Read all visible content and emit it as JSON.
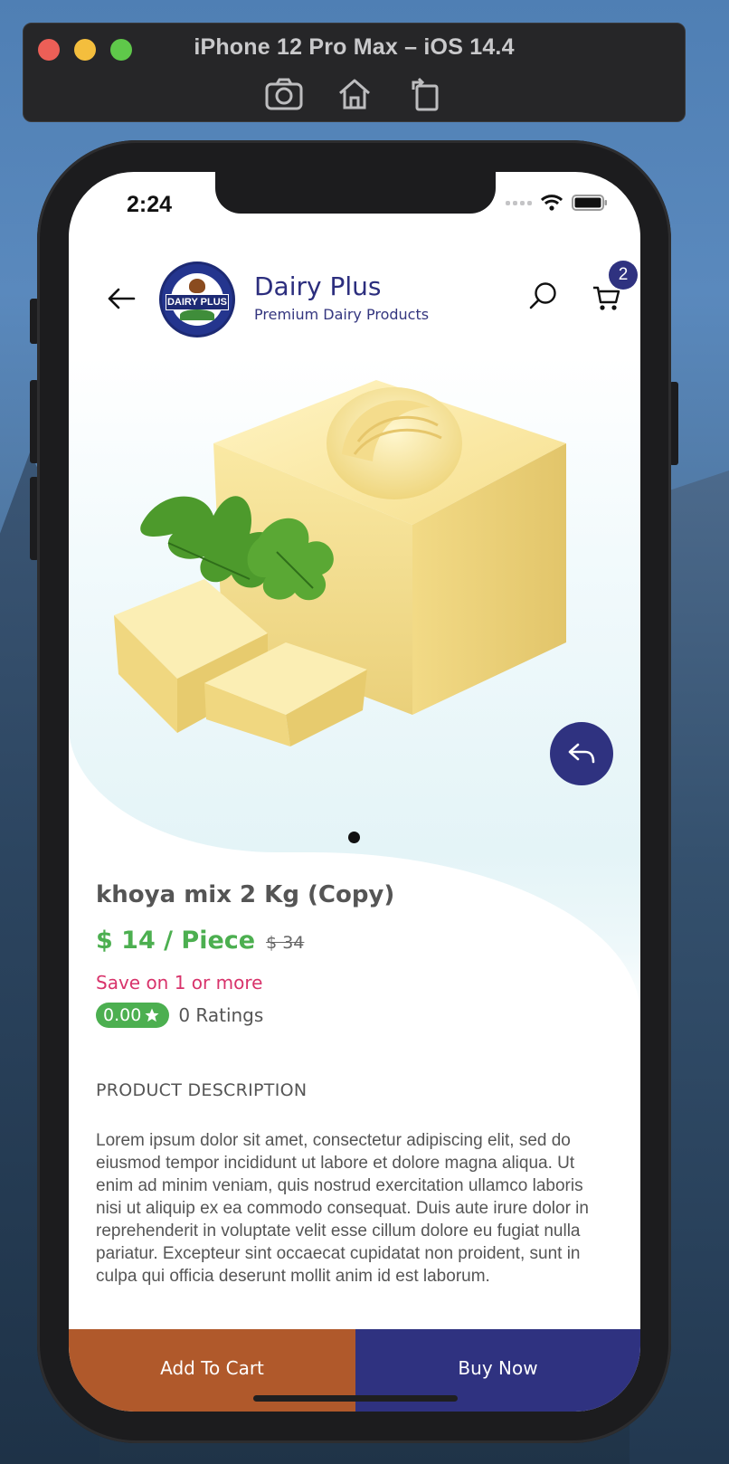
{
  "simulator": {
    "title": "iPhone 12 Pro Max – iOS 14.4",
    "tools": [
      "screenshot-icon",
      "home-icon",
      "rotate-icon"
    ]
  },
  "status_bar": {
    "time": "2:24",
    "icons": [
      "signal-icon",
      "wifi-icon",
      "battery-icon"
    ]
  },
  "header": {
    "brand_title": "Dairy Plus",
    "brand_subtitle": "Premium Dairy Products",
    "logo_text": "DAIRY PLUS",
    "cart_count": "2"
  },
  "hero": {
    "image_icon": "butter-image",
    "page_dots": 1
  },
  "product": {
    "name": "khoya mix 2 Kg (Copy)",
    "price": "$ 14 / Piece",
    "old_price": "$ 34",
    "save_text": "Save on 1 or more",
    "rating_value": "0.00",
    "rating_count": "0 Ratings",
    "description_heading": "PRODUCT DESCRIPTION",
    "description": "Lorem ipsum dolor sit amet, consectetur adipiscing elit, sed do eiusmod tempor incididunt ut labore et dolore magna aliqua. Ut enim ad minim veniam, quis nostrud exercitation ullamco laboris nisi ut aliquip ex ea commodo consequat. Duis aute irure dolor in reprehenderit in voluptate velit esse cillum dolore eu fugiat nulla pariatur. Excepteur sint occaecat cupidatat non proident, sunt in culpa qui officia deserunt mollit anim id est laborum."
  },
  "actions": {
    "add_to_cart": "Add To Cart",
    "buy_now": "Buy Now"
  },
  "colors": {
    "brand_navy": "#2f3280",
    "cart_orange": "#b0592b",
    "price_green": "#4caf50",
    "save_pink": "#d8336b"
  }
}
